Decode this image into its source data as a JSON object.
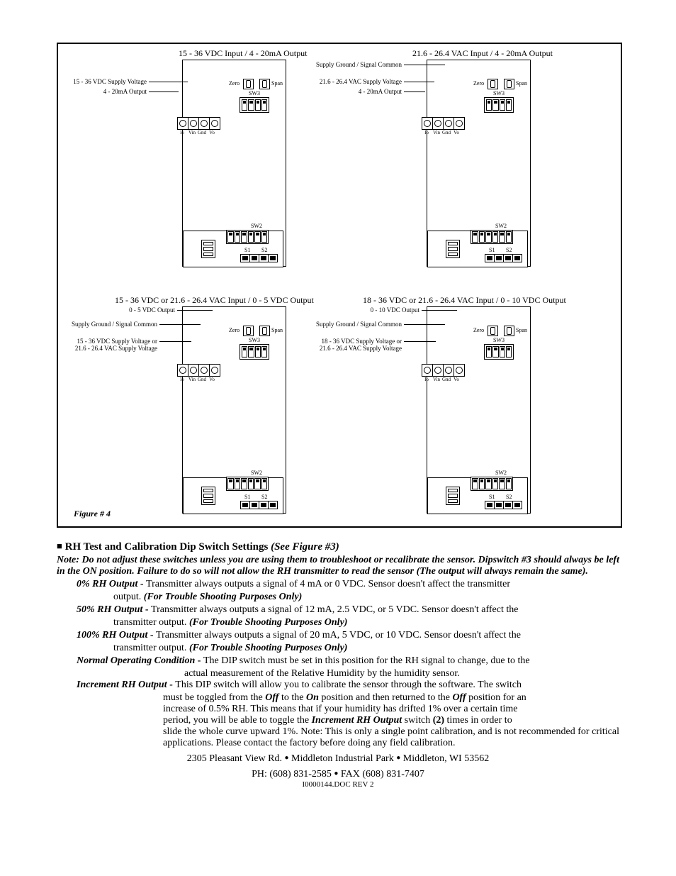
{
  "diagrams": {
    "d1": {
      "title": "15 - 36 VDC Input / 4 - 20mA Output",
      "l1": "15 - 36 VDC Supply Voltage",
      "l2": "4 - 20mA Output",
      "zero": "Zero",
      "span": "Span",
      "sw3": "SW3",
      "sw2": "SW2",
      "s1": "S1",
      "s2": "S2",
      "t1": "Io",
      "t2": "Vin",
      "t3": "Gnd",
      "t4": "Vo"
    },
    "d2": {
      "title": "21.6 - 26.4 VAC Input / 4 - 20mA Output",
      "l0": "Supply Ground / Signal Common",
      "l1": "21.6 - 26.4 VAC Supply Voltage",
      "l2": "4 - 20mA Output",
      "zero": "Zero",
      "span": "Span",
      "sw3": "SW3",
      "sw2": "SW2",
      "s1": "S1",
      "s2": "S2",
      "t1": "Io",
      "t2": "Vin",
      "t3": "Gnd",
      "t4": "Vo"
    },
    "d3": {
      "title": "15 - 36 VDC or 21.6 - 26.4 VAC Input / 0 - 5 VDC Output",
      "l_out": "0 - 5 VDC Output",
      "l0": "Supply Ground / Signal Common",
      "l1a": "15 - 36 VDC Supply Voltage or",
      "l1b": "21.6 - 26.4 VAC Supply Voltage",
      "zero": "Zero",
      "span": "Span",
      "sw3": "SW3",
      "sw2": "SW2",
      "s1": "S1",
      "s2": "S2",
      "t1": "Io",
      "t2": "Vin",
      "t3": "Gnd",
      "t4": "Vo"
    },
    "d4": {
      "title": "18 - 36 VDC or 21.6 - 26.4 VAC Input / 0 - 10 VDC Output",
      "l_out": "0 - 10 VDC Output",
      "l0": "Supply Ground / Signal Common",
      "l1a": "18 - 36 VDC Supply Voltage or",
      "l1b": "21.6 - 26.4 VAC Supply Voltage",
      "zero": "Zero",
      "span": "Span",
      "sw3": "SW3",
      "sw2": "SW2",
      "s1": "S1",
      "s2": "S2",
      "t1": "Io",
      "t2": "Vin",
      "t3": "Gnd",
      "t4": "Vo"
    },
    "figure_label": "Figure # 4"
  },
  "heading": {
    "bullet": "■",
    "title": "RH Test and Calibration Dip Switch Settings",
    "see": "(See Figure #3)"
  },
  "note": "Note:  Do not adjust these switches unless you are using them to troubleshoot or recalibrate the sensor.  Dipswitch #3 should always be left in the ON position.  Failure to do so will not allow the RH transmitter to read the sensor (The output will always remain the same).",
  "entries": {
    "e1": {
      "term": "0% RH Output",
      "body_a": "Transmitter always outputs a signal of 4 mA or 0 VDC.  Sensor doesn't affect the transmitter",
      "body_b": "output.  ",
      "trouble": "(For Trouble Shooting Purposes Only)"
    },
    "e2": {
      "term": "50% RH Output",
      "body_a": "Transmitter always outputs a signal of 12 mA, 2.5 VDC, or 5 VDC.  Sensor doesn't affect the",
      "body_b": "transmitter output.  ",
      "trouble": "(For Trouble Shooting Purposes Only)"
    },
    "e3": {
      "term": "100% RH Output",
      "body_a": "Transmitter always outputs a signal of 20 mA, 5 VDC, or 10 VDC.  Sensor doesn't affect the",
      "body_b": "transmitter output.  ",
      "trouble": "(For Trouble Shooting Purposes Only)"
    },
    "e4": {
      "term": "Normal Operating Condition",
      "body_a": "The DIP switch must be set in this position for the RH signal to change, due to the",
      "body_b": "actual measurement of the Relative Humidity  by the humidity sensor."
    },
    "e5": {
      "term": "Increment RH Output",
      "body_a": "This DIP switch will allow you to calibrate the sensor through the software.  The switch",
      "body_b1": "must be toggled from the ",
      "off": "Off",
      "body_b2": " to the ",
      "on": "On",
      "body_b3": " position and then returned to the ",
      "off2": "Off",
      "body_b4": " position for an",
      "body_c": "increase of 0.5% RH.  This means that if your humidity has drifted 1% over a certain time",
      "body_d1": "period, you will be able to toggle the ",
      "incr": "Increment RH Output",
      "body_d2": " switch ",
      "two": "(2)",
      "body_d3": " times in order to",
      "body_e1": " slide the whole curve upward 1%.  ",
      "note_tail": "Note:  This is only a single point calibration, and is not recommended for critical applications.  Please contact the factory before doing any field calibration."
    }
  },
  "footer": {
    "addr1": "2305 Pleasant View Rd.",
    "addr2": "Middleton Industrial Park",
    "addr3": "Middleton, WI 53562",
    "ph_label": "PH: (608) 831-2585",
    "fax_label": "FAX (608) 831-7407",
    "dot": "●",
    "docrev": "I0000144.DOC REV 2"
  }
}
